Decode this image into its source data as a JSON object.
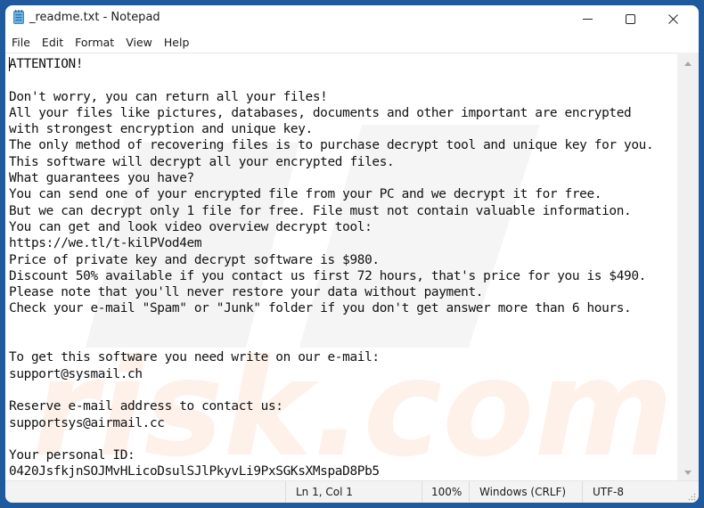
{
  "window": {
    "title": "_readme.txt - Notepad",
    "app_icon": "notepad-icon",
    "controls": {
      "minimize_icon": "minimize-icon",
      "maximize_icon": "maximize-icon",
      "close_icon": "close-icon"
    }
  },
  "menu": {
    "items": [
      {
        "label": "File"
      },
      {
        "label": "Edit"
      },
      {
        "label": "Format"
      },
      {
        "label": "View"
      },
      {
        "label": "Help"
      }
    ]
  },
  "document": {
    "lines": [
      "ATTENTION!",
      "",
      "Don't worry, you can return all your files!",
      "All your files like pictures, databases, documents and other important are encrypted",
      "with strongest encryption and unique key.",
      "The only method of recovering files is to purchase decrypt tool and unique key for you.",
      "This software will decrypt all your encrypted files.",
      "What guarantees you have?",
      "You can send one of your encrypted file from your PC and we decrypt it for free.",
      "But we can decrypt only 1 file for free. File must not contain valuable information.",
      "You can get and look video overview decrypt tool:",
      "https://we.tl/t-kilPVod4em",
      "Price of private key and decrypt software is $980.",
      "Discount 50% available if you contact us first 72 hours, that's price for you is $490.",
      "Please note that you'll never restore your data without payment.",
      "Check your e-mail \"Spam\" or \"Junk\" folder if you don't get answer more than 6 hours.",
      "",
      "",
      "To get this software you need write on our e-mail:",
      "support@sysmail.ch",
      "",
      "Reserve e-mail address to contact us:",
      "supportsys@airmail.cc",
      "",
      "Your personal ID:",
      "0420JsfkjnSOJMvHLicoDsulSJlPkyvLi9PxSGKsXMspaD8Pb5"
    ]
  },
  "statusbar": {
    "position": "Ln 1, Col 1",
    "zoom": "100%",
    "line_ending": "Windows (CRLF)",
    "encoding": "UTF-8"
  },
  "colors": {
    "desktop": "#1f5a9e",
    "statusbar_bg": "#f3f3f3",
    "scrollbar_bg": "#f0f0f0"
  }
}
